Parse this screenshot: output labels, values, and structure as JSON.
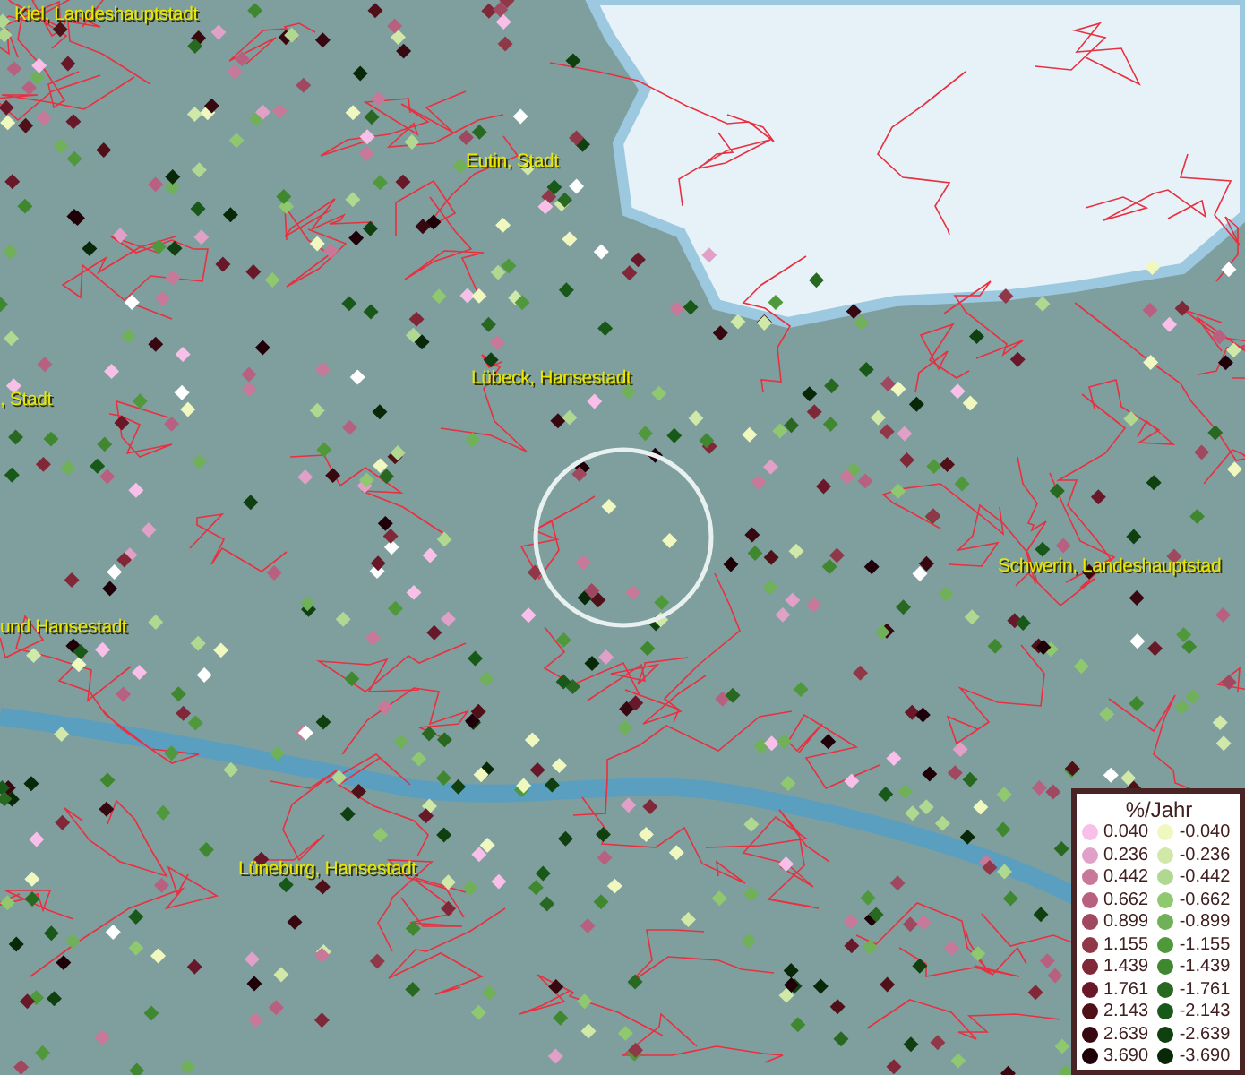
{
  "map": {
    "places": [
      {
        "name": "Kiel, Landeshauptstadt"
      },
      {
        "name": "Eutin, Stadt"
      },
      {
        "name": ", Stadt"
      },
      {
        "name": "Lübeck, Hansestadt"
      },
      {
        "name": "Schwerin, Landeshauptstad"
      },
      {
        "name": "und Hansestadt"
      },
      {
        "name": "Lüneburg, Hansestadt"
      }
    ]
  },
  "legend": {
    "title": "%/Jahr",
    "positive": [
      {
        "label": "0.040",
        "color": "#f8c0e8"
      },
      {
        "label": "0.236",
        "color": "#e0a0c8"
      },
      {
        "label": "0.442",
        "color": "#c87898"
      },
      {
        "label": "0.662",
        "color": "#b86080"
      },
      {
        "label": "0.899",
        "color": "#a04860"
      },
      {
        "label": "1.155",
        "color": "#903848"
      },
      {
        "label": "1.439",
        "color": "#802838"
      },
      {
        "label": "1.761",
        "color": "#681828"
      },
      {
        "label": "2.143",
        "color": "#501018"
      },
      {
        "label": "2.639",
        "color": "#380810"
      },
      {
        "label": "3.690",
        "color": "#200008"
      }
    ],
    "negative": [
      {
        "label": "-0.040",
        "color": "#f0f8c0"
      },
      {
        "label": "-0.236",
        "color": "#d0e8a8"
      },
      {
        "label": "-0.442",
        "color": "#b0d890"
      },
      {
        "label": "-0.662",
        "color": "#90c870"
      },
      {
        "label": "-0.899",
        "color": "#70b058"
      },
      {
        "label": "-1.155",
        "color": "#50983c"
      },
      {
        "label": "-1.439",
        "color": "#408830"
      },
      {
        "label": "-1.761",
        "color": "#286820"
      },
      {
        "label": "-2.143",
        "color": "#185818"
      },
      {
        "label": "-2.639",
        "color": "#104010"
      },
      {
        "label": "-3.690",
        "color": "#082808"
      }
    ]
  }
}
